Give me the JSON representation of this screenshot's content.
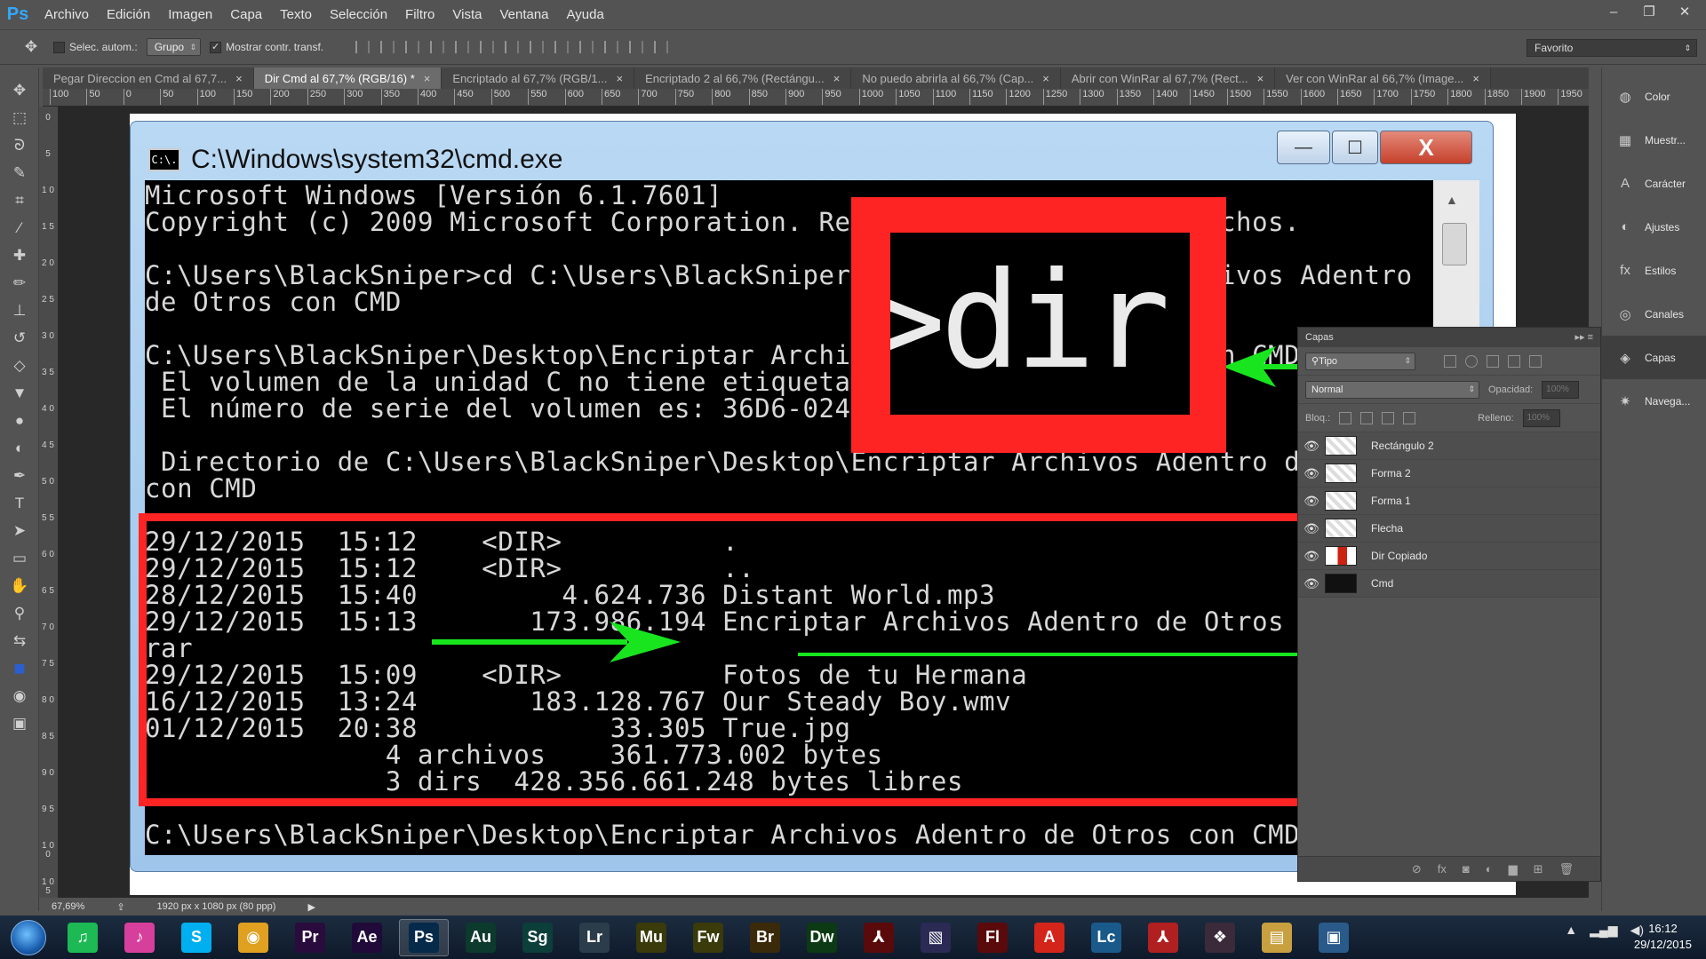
{
  "menubar": {
    "logo": "Ps",
    "items": [
      "Archivo",
      "Edición",
      "Imagen",
      "Capa",
      "Texto",
      "Selección",
      "Filtro",
      "Vista",
      "Ventana",
      "Ayuda"
    ],
    "win_minimize": "–",
    "win_restore": "❐",
    "win_close": "✕"
  },
  "options": {
    "auto_select_label": "Selec. autom.:",
    "auto_select_value": "Grupo",
    "show_transform_label": "Mostrar contr. transf.",
    "workspace": "Favorito"
  },
  "tabs": [
    {
      "label": "Pegar Direccion en Cmd al 67,7...",
      "active": false
    },
    {
      "label": "Dir Cmd al 67,7% (RGB/16) *",
      "active": true
    },
    {
      "label": "Encriptado al 67,7% (RGB/1...",
      "active": false
    },
    {
      "label": "Encriptado 2 al 66,7% (Rectángu...",
      "active": false
    },
    {
      "label": "No puedo abrirla al 66,7% (Cap...",
      "active": false
    },
    {
      "label": "Abrir con WinRar al 67,7% (Rect...",
      "active": false
    },
    {
      "label": "Ver con WinRar al 66,7% (Image...",
      "active": false
    }
  ],
  "tab_close": "×",
  "ruler": {
    "h_ticks": [
      "100",
      "50",
      "0",
      "50",
      "100",
      "150",
      "200",
      "250",
      "300",
      "350",
      "400",
      "450",
      "500",
      "550",
      "600",
      "650",
      "700",
      "750",
      "800",
      "850",
      "900",
      "950",
      "1000",
      "1050",
      "1100",
      "1150",
      "1200",
      "1250",
      "1300",
      "1350",
      "1400",
      "1450",
      "1500",
      "1550",
      "1600",
      "1650",
      "1700",
      "1750",
      "1800",
      "1850",
      "1900",
      "1950"
    ],
    "v_ticks": [
      "0",
      "5",
      "1 0",
      "1 5",
      "2 0",
      "2 5",
      "3 0",
      "3 5",
      "4 0",
      "4 5",
      "5 0",
      "5 5",
      "6 0",
      "6 5",
      "7 0",
      "7 5",
      "8 0",
      "8 5",
      "9 0",
      "9 5",
      "1 0 0",
      "1 0 5"
    ]
  },
  "tools": [
    "move-tool",
    "marquee-tool",
    "lasso-tool",
    "quick-select-tool",
    "crop-tool",
    "eyedropper-tool",
    "healing-tool",
    "brush-tool",
    "stamp-tool",
    "history-brush-tool",
    "eraser-tool",
    "bucket-tool",
    "blur-tool",
    "dodge-tool",
    "pen-tool",
    "type-tool",
    "path-select-tool",
    "shape-tool",
    "hand-tool",
    "zoom-tool",
    "swap-colors-icon",
    "foreground-color",
    "quick-mask-tool",
    "screen-mode-tool"
  ],
  "tool_glyphs": [
    "✥",
    "⬚",
    "ᘐ",
    "✎",
    "⌗",
    "⁄",
    "✚",
    "✏",
    "⊥",
    "↺",
    "◇",
    "▼",
    "●",
    "◐",
    "✒",
    "T",
    "➤",
    "▭",
    "✋",
    "⚲",
    "⇆",
    "■",
    "◉",
    "▣"
  ],
  "cmd": {
    "title": "C:\\Windows\\system32\\cmd.exe",
    "icon_text": "C:\\.",
    "min": "—",
    "max": "☐",
    "close": "X",
    "lines": [
      {
        "text": "Microsoft Windows [Versión 6.1.7601]"
      },
      {
        "text": "Copyright (c) 2009 Microsoft Corporation. Reservados todos los derechos."
      },
      {
        "text": ""
      },
      {
        "text": "C:\\Users\\BlackSniper>cd C:\\Users\\BlackSniper\\Desktop\\Encriptar Archivos Adentro"
      },
      {
        "text": "de Otros con CMD"
      },
      {
        "text": ""
      },
      {
        "text": "C:\\Users\\BlackSniper\\Desktop\\Encriptar Archivos Adentro de Otros con CMD>dir"
      },
      {
        "text": " El volumen de la unidad C no tiene etiqueta."
      },
      {
        "text": " El número de serie del volumen es: 36D6-0242"
      },
      {
        "text": ""
      },
      {
        "text": " Directorio de C:\\Users\\BlackSniper\\Desktop\\Encriptar Archivos Adentro de Otros"
      },
      {
        "text": "con CMD"
      },
      {
        "text": ""
      },
      {
        "text": "29/12/2015  15:12    <DIR>          ."
      },
      {
        "text": "29/12/2015  15:12    <DIR>          .."
      },
      {
        "text": "28/12/2015  15:40         4.624.736 Distant World.mp3"
      },
      {
        "text": "29/12/2015  15:13       173.986.194 Encriptar Archivos Adentro de Otros con CMD."
      },
      {
        "text": "rar"
      },
      {
        "text": "29/12/2015  15:09    <DIR>          Fotos de tu Hermana"
      },
      {
        "text": "16/12/2015  13:24       183.128.767 Our Steady Boy.wmv"
      },
      {
        "text": "01/12/2015  20:38            33.305 True.jpg"
      },
      {
        "text": "               4 archivos    361.773.002 bytes"
      },
      {
        "text": "               3 dirs  428.356.661.248 bytes libres"
      },
      {
        "text": ""
      },
      {
        "text": "C:\\Users\\BlackSniper\\Desktop\\Encriptar Archivos Adentro de Otros con CMD>"
      }
    ],
    "zoom_text": ">dir"
  },
  "layers_panel": {
    "title": "Capas",
    "filter": "Tipo",
    "blend": "Normal",
    "opacity_label": "Opacidad:",
    "opacity_value": "100%",
    "lock_label": "Bloq.:",
    "fill_label": "Relleno:",
    "fill_value": "100%",
    "layers": [
      {
        "name": "Rectángulo 2",
        "thumb": "plain"
      },
      {
        "name": "Forma 2",
        "thumb": "plain"
      },
      {
        "name": "Forma 1",
        "thumb": "plain"
      },
      {
        "name": "Flecha",
        "thumb": "plain"
      },
      {
        "name": "Dir Copiado",
        "thumb": "red"
      },
      {
        "name": "Cmd",
        "thumb": "dark"
      }
    ],
    "footer_icons": [
      "⊘",
      "fx",
      "◙",
      "◐",
      "▆",
      "⊞",
      "🗑"
    ]
  },
  "dock": [
    {
      "label": "Color",
      "icon": "◍",
      "active": false
    },
    {
      "label": "Muestr...",
      "icon": "▦",
      "active": false
    },
    {
      "label": "Carácter",
      "icon": "A",
      "active": false
    },
    {
      "label": "Ajustes",
      "icon": "◐",
      "active": false
    },
    {
      "label": "Estilos",
      "icon": "fx",
      "active": false
    },
    {
      "label": "Canales",
      "icon": "◎",
      "active": false
    },
    {
      "label": "Capas",
      "icon": "◈",
      "active": true
    },
    {
      "label": "Navega...",
      "icon": "✷",
      "active": false
    }
  ],
  "status": {
    "zoom": "67,69%",
    "doc_info": "1920 px x 1080 px (80 ppp)"
  },
  "taskbar": {
    "apps": [
      {
        "name": "spotify",
        "text": "♫",
        "color": "#1db954"
      },
      {
        "name": "itunes",
        "text": "♪",
        "color": "#d63f9b"
      },
      {
        "name": "skype",
        "text": "S",
        "color": "#00aff0"
      },
      {
        "name": "chrome",
        "text": "◉",
        "color": "#e0a020"
      },
      {
        "name": "premiere",
        "text": "Pr",
        "color": "#2a0b3e"
      },
      {
        "name": "after-effects",
        "text": "Ae",
        "color": "#1f0a3a"
      },
      {
        "name": "photoshop",
        "text": "Ps",
        "color": "#062a4a"
      },
      {
        "name": "audition",
        "text": "Au",
        "color": "#0c3a2c"
      },
      {
        "name": "speedgrade",
        "text": "Sg",
        "color": "#0c3f3a"
      },
      {
        "name": "lightroom",
        "text": "Lr",
        "color": "#2b3d4a"
      },
      {
        "name": "muse",
        "text": "Mu",
        "color": "#3a3a0a"
      },
      {
        "name": "fireworks",
        "text": "Fw",
        "color": "#3a3a0a"
      },
      {
        "name": "bridge",
        "text": "Br",
        "color": "#3a2a0a"
      },
      {
        "name": "dreamweaver",
        "text": "Dw",
        "color": "#0c3a14"
      },
      {
        "name": "acrobat",
        "text": "⅄",
        "color": "#5a0a0a"
      },
      {
        "name": "illustrator-tool",
        "text": "▧",
        "color": "#2a2a55"
      },
      {
        "name": "flash",
        "text": "Fl",
        "color": "#5a0a0a"
      },
      {
        "name": "adobe",
        "text": "A",
        "color": "#d4251a"
      },
      {
        "name": "livecycle",
        "text": "Lc",
        "color": "#1a5a8a"
      },
      {
        "name": "pdf",
        "text": "⅄",
        "color": "#b02020"
      },
      {
        "name": "game-app",
        "text": "❖",
        "color": "#3a2a3a"
      },
      {
        "name": "explorer",
        "text": "▤",
        "color": "#c8a040"
      },
      {
        "name": "desktop-app",
        "text": "▣",
        "color": "#2a5a8a"
      }
    ],
    "active_app": "photoshop",
    "time": "16:12",
    "date": "29/12/2015"
  }
}
